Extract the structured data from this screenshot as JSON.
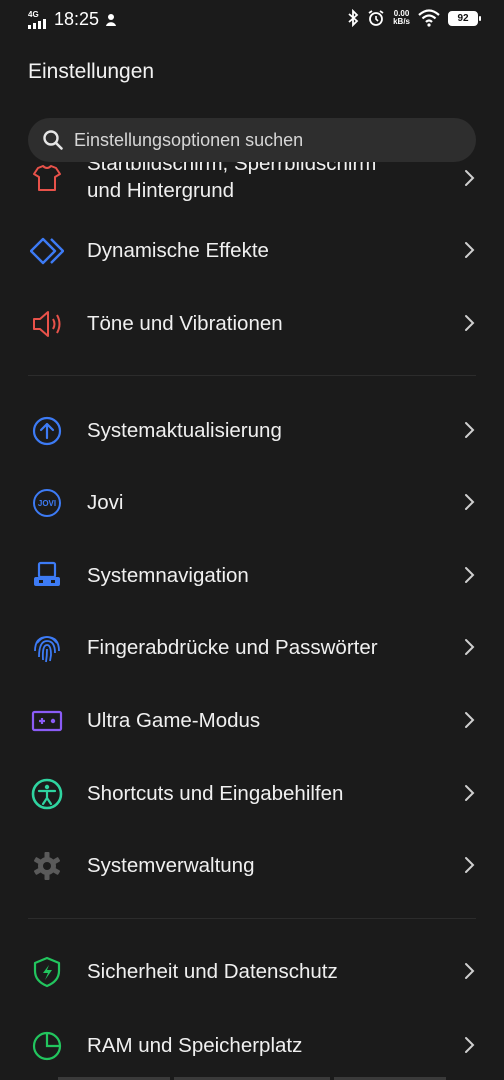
{
  "status_bar": {
    "network": "4G",
    "time": "18:25",
    "speed_value": "0.00",
    "speed_unit": "kB/s",
    "battery": "92"
  },
  "header": {
    "title": "Einstellungen"
  },
  "search": {
    "placeholder": "Einstellungsoptionen suchen"
  },
  "items": {
    "home": {
      "label_top": "Startbildschirm, Sperrbildschirm",
      "label_bottom": "und Hintergrund",
      "icon": "shirt-icon",
      "color": "#e8524a"
    },
    "effects": {
      "label": "Dynamische Effekte",
      "icon": "diamond-icon",
      "color": "#3d7bf5"
    },
    "sound": {
      "label": "Töne und Vibrationen",
      "icon": "speaker-icon",
      "color": "#e8524a"
    },
    "update": {
      "label": "Systemaktualisierung",
      "icon": "arrow-up-circle-icon",
      "color": "#3d7bf5"
    },
    "jovi": {
      "label": "Jovi",
      "icon": "jovi-icon",
      "icon_text": "JOVI",
      "color": "#3d7bf5"
    },
    "navigation": {
      "label": "Systemnavigation",
      "icon": "navigation-icon",
      "color": "#3d7bf5"
    },
    "fingerprint": {
      "label": "Fingerabdrücke und Passwörter",
      "icon": "fingerprint-icon",
      "color": "#3d7bf5"
    },
    "game": {
      "label": "Ultra Game-Modus",
      "icon": "gamepad-icon",
      "color": "#8b5cf6"
    },
    "accessibility": {
      "label": "Shortcuts und Eingabehilfen",
      "icon": "accessibility-icon",
      "color": "#2fd4a0"
    },
    "system": {
      "label": "Systemverwaltung",
      "icon": "gear-icon",
      "color": "#5a5a5a"
    },
    "security": {
      "label": "Sicherheit und Datenschutz",
      "icon": "shield-icon",
      "color": "#22c55e"
    },
    "storage": {
      "label": "RAM und Speicherplatz",
      "icon": "pie-chart-icon",
      "color": "#22c55e"
    }
  }
}
